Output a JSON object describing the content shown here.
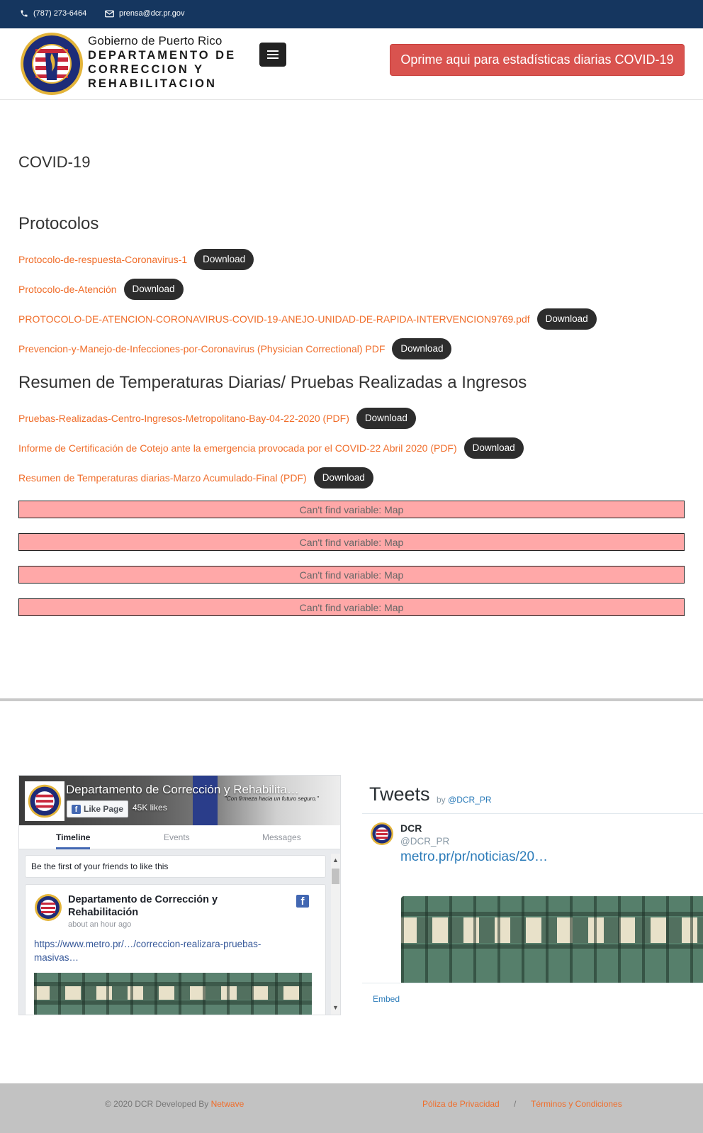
{
  "topbar": {
    "phone": "(787) 273-6464",
    "email": "prensa@dcr.pr.gov"
  },
  "header": {
    "gov_line": "Gobierno de Puerto Rico",
    "dept_line1": "DEPARTAMENTO DE",
    "dept_line2": "CORRECCION Y",
    "dept_line3": "REHABILITACION",
    "covid_button": "Oprime aqui para estadísticas diarias COVID-19"
  },
  "main": {
    "title": "COVID-19",
    "protocolos": {
      "heading": "Protocolos",
      "items": [
        {
          "label": "Protocolo-de-respuesta-Coronavirus-1",
          "button": "Download"
        },
        {
          "label": "Protocolo-de-Atención",
          "button": "Download"
        },
        {
          "label": "PROTOCOLO-DE-ATENCION-CORONAVIRUS-COVID-19-ANEJO-UNIDAD-DE-RAPIDA-INTERVENCION9769.pdf",
          "button": "Download"
        },
        {
          "label": "Prevencion-y-Manejo-de-Infecciones-por-Coronavirus (Physician Correctional) PDF",
          "button": "Download"
        }
      ]
    },
    "resumen": {
      "heading": "Resumen de Temperaturas Diarias/ Pruebas Realizadas a Ingresos",
      "items": [
        {
          "label": "Pruebas-Realizadas-Centro-Ingresos-Metropolitano-Bay-04-22-2020 (PDF)",
          "button": "Download"
        },
        {
          "label": "Informe de Certificación de Cotejo ante la emergencia provocada por el COVID-22 Abril 2020 (PDF)",
          "button": "Download"
        },
        {
          "label": "Resumen de Temperaturas diarias-Marzo Acumulado-Final (PDF)",
          "button": "Download"
        }
      ]
    },
    "errors": [
      "Can't find variable: Map",
      "Can't find variable: Map",
      "Can't find variable: Map",
      "Can't find variable: Map"
    ]
  },
  "facebook": {
    "page_name": "Departamento de Corrección y Rehabilita…",
    "like_button": "Like Page",
    "likes": "45K likes",
    "slogan": "\"Con firmeza hacia un futuro seguro.\"",
    "tabs": [
      "Timeline",
      "Events",
      "Messages"
    ],
    "friends_text": "Be the first of your friends to like this",
    "post": {
      "author": "Departamento de Corrección y Rehabilitación",
      "time": "about an hour ago",
      "link": "https://www.metro.pr/…/correccion-realizara-pruebas-masivas…"
    }
  },
  "twitter": {
    "title": "Tweets",
    "by_prefix": "by",
    "by_handle": "@DCR_PR",
    "tweet": {
      "name": "DCR",
      "handle": "@DCR_PR",
      "link": "metro.pr/pr/noticias/20…"
    },
    "embed": "Embed"
  },
  "footer": {
    "copyright": "© 2020 DCR Developed By",
    "developer": "Netwave",
    "privacy": "Póliza de Privacidad",
    "separator": "/",
    "terms": "Términos y Condiciones"
  },
  "colors": {
    "topbar": "#15365f",
    "accent_link": "#f06d2a",
    "covid_button": "#d9534f",
    "download_button": "#2d2d2d",
    "error_bar": "#ffa8a8",
    "footer": "#c2c2c2"
  },
  "icons": {
    "phone": "phone-icon",
    "email": "envelope-icon",
    "menu": "hamburger-menu-icon",
    "facebook": "facebook-icon"
  }
}
